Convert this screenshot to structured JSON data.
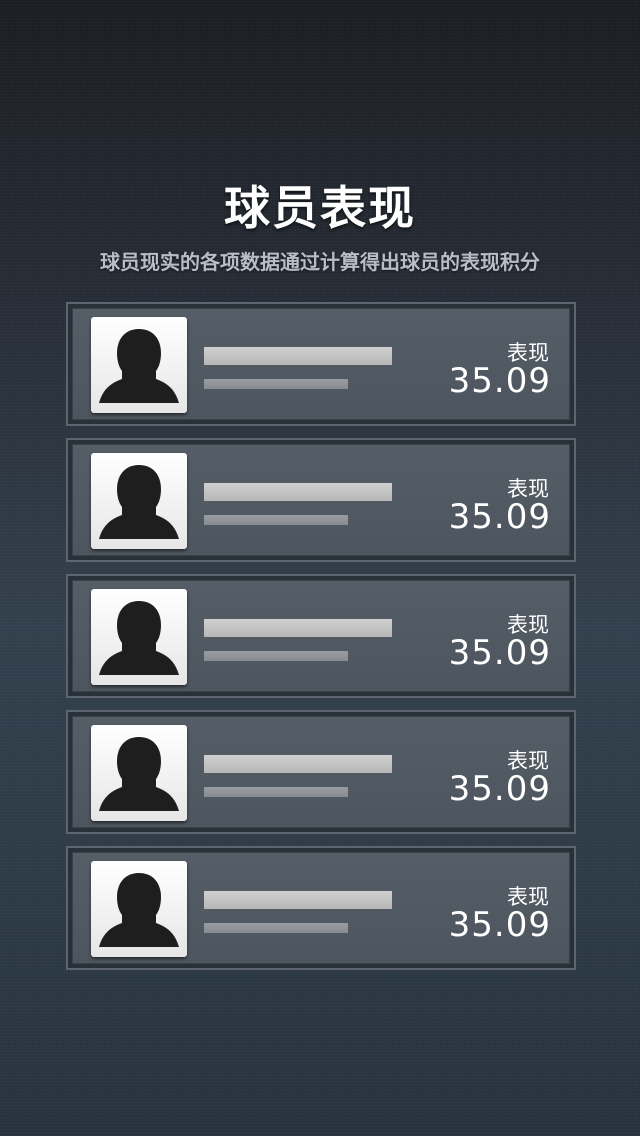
{
  "header": {
    "title": "球员表现",
    "subtitle": "球员现实的各项数据通过计算得出球员的表现积分"
  },
  "players": [
    {
      "score_label": "表现",
      "score": "35.09",
      "avatar_icon": "person-silhouette-icon"
    },
    {
      "score_label": "表现",
      "score": "35.09",
      "avatar_icon": "person-silhouette-icon"
    },
    {
      "score_label": "表现",
      "score": "35.09",
      "avatar_icon": "person-silhouette-icon"
    },
    {
      "score_label": "表现",
      "score": "35.09",
      "avatar_icon": "person-silhouette-icon"
    },
    {
      "score_label": "表现",
      "score": "35.09",
      "avatar_icon": "person-silhouette-icon"
    }
  ],
  "colors": {
    "background_top": "#1b1d22",
    "background_bottom": "#26323d",
    "card": "#555d66",
    "text": "#ffffff"
  }
}
